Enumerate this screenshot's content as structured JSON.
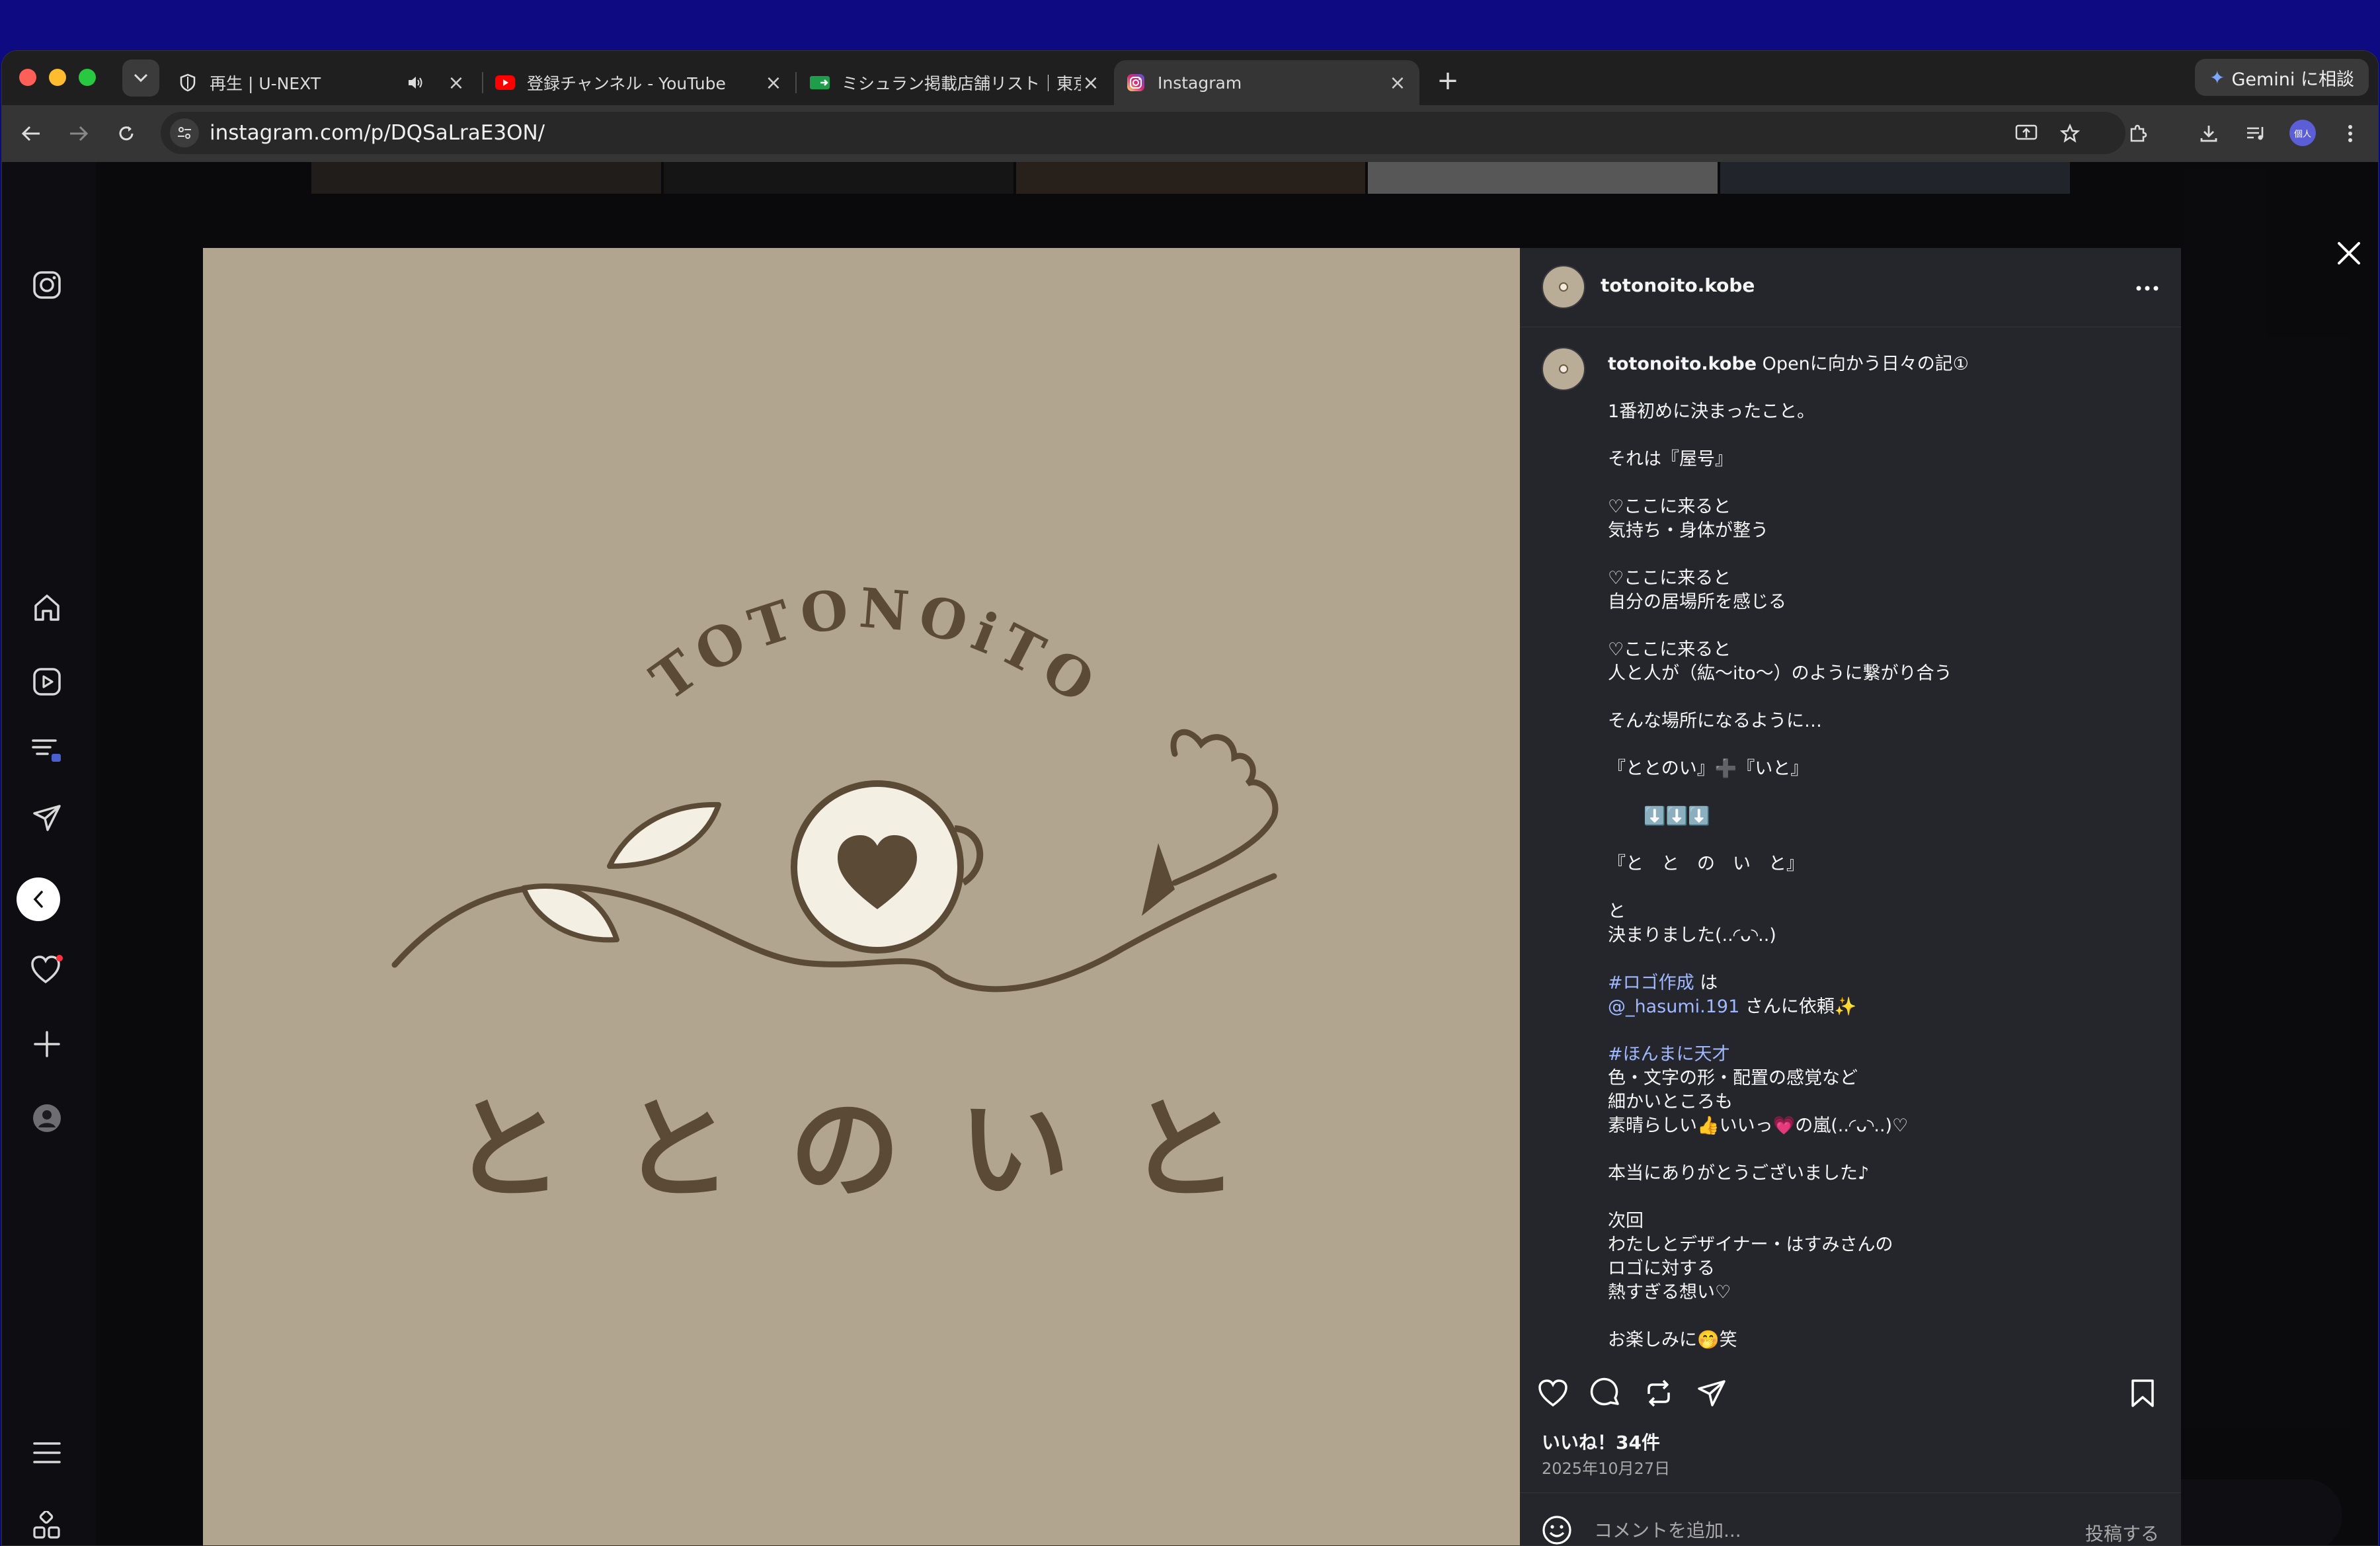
{
  "browser": {
    "tabs": [
      {
        "title": "再生 | U-NEXT",
        "favicon": "shield-icon",
        "audio": true
      },
      {
        "title": "登録チャンネル - YouTube",
        "favicon": "youtube-icon"
      },
      {
        "title": "ミシュラン掲載店舗リスト｜東京",
        "favicon": "sheets-icon"
      },
      {
        "title": "Instagram",
        "favicon": "instagram-icon",
        "active": true
      }
    ],
    "url": "instagram.com/p/DQSaLraE3ON/",
    "gemini_label": "Gemini に相談",
    "profile_chip": "個人"
  },
  "post": {
    "username": "totonoito.kobe",
    "logo": {
      "arc_text": "TOTONOiTO",
      "kana_text": "ととのいと",
      "bg_color": "#b2a590",
      "ink_color": "#5a4a36"
    },
    "caption": {
      "title": "Openに向かう日々の記①",
      "line1": "1番初めに決まったこと。",
      "line2": "それは『屋号』",
      "line3": "♡ここに来ると\n気持ち・身体が整う",
      "line4": "♡ここに来ると\n自分の居場所を感じる",
      "line5": "♡ここに来ると\n人と人が（紘〜ito〜）のように繋がり合う",
      "line6": "そんな場所になるように…",
      "line7": "『ととのい』➕『いと』",
      "line8": "　　⬇️⬇️⬇️",
      "line9": "『と　と　の　い　と』",
      "line10": "と\n決まりました(..◜ᴗ◝..)",
      "hashtag1": "#ロゴ作成",
      "text_wa": " は",
      "mention": "@_hasumi.191",
      "text_irai": " さんに依頼✨",
      "hashtag2": "#ほんまに天才",
      "line11": "色・文字の形・配置の感覚など\n細かいところも\n素晴らしい👍いいっ💗の嵐(..◜ᴗ◝..)♡",
      "line12": "本当にありがとうございました♪",
      "line13": "次回\nわたしとデザイナー・はすみさんの\nロゴに対する\n熱すぎる想い♡",
      "line14": "お楽しみに🤭笑"
    },
    "likes": "いいね！34件",
    "date": "2025年10月27日",
    "comment_placeholder": "コメントを追加...",
    "post_button": "投稿する"
  },
  "colors": {
    "accent_link": "#a0b8ff",
    "panel_bg": "#25262b",
    "notification_dot": "#ff3040"
  }
}
